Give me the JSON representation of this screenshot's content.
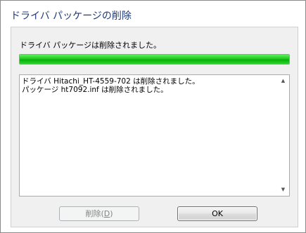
{
  "window": {
    "title": "ドライバ パッケージの削除"
  },
  "status": {
    "message": "ドライバ パッケージは削除されました。",
    "progress": 1.0,
    "progress_color": "#06b006"
  },
  "log": {
    "lines": [
      "ドライバ Hitachi_HT-4559-702 は削除されました。",
      "パッケージ ht7092.inf は削除されました。"
    ],
    "scroll_up_icon": "arrow-up",
    "scroll_down_icon": "arrow-down"
  },
  "buttons": {
    "delete_label": "削除(",
    "delete_accel": "D",
    "delete_label_end": ")",
    "delete_enabled": false,
    "ok_label": "OK"
  }
}
